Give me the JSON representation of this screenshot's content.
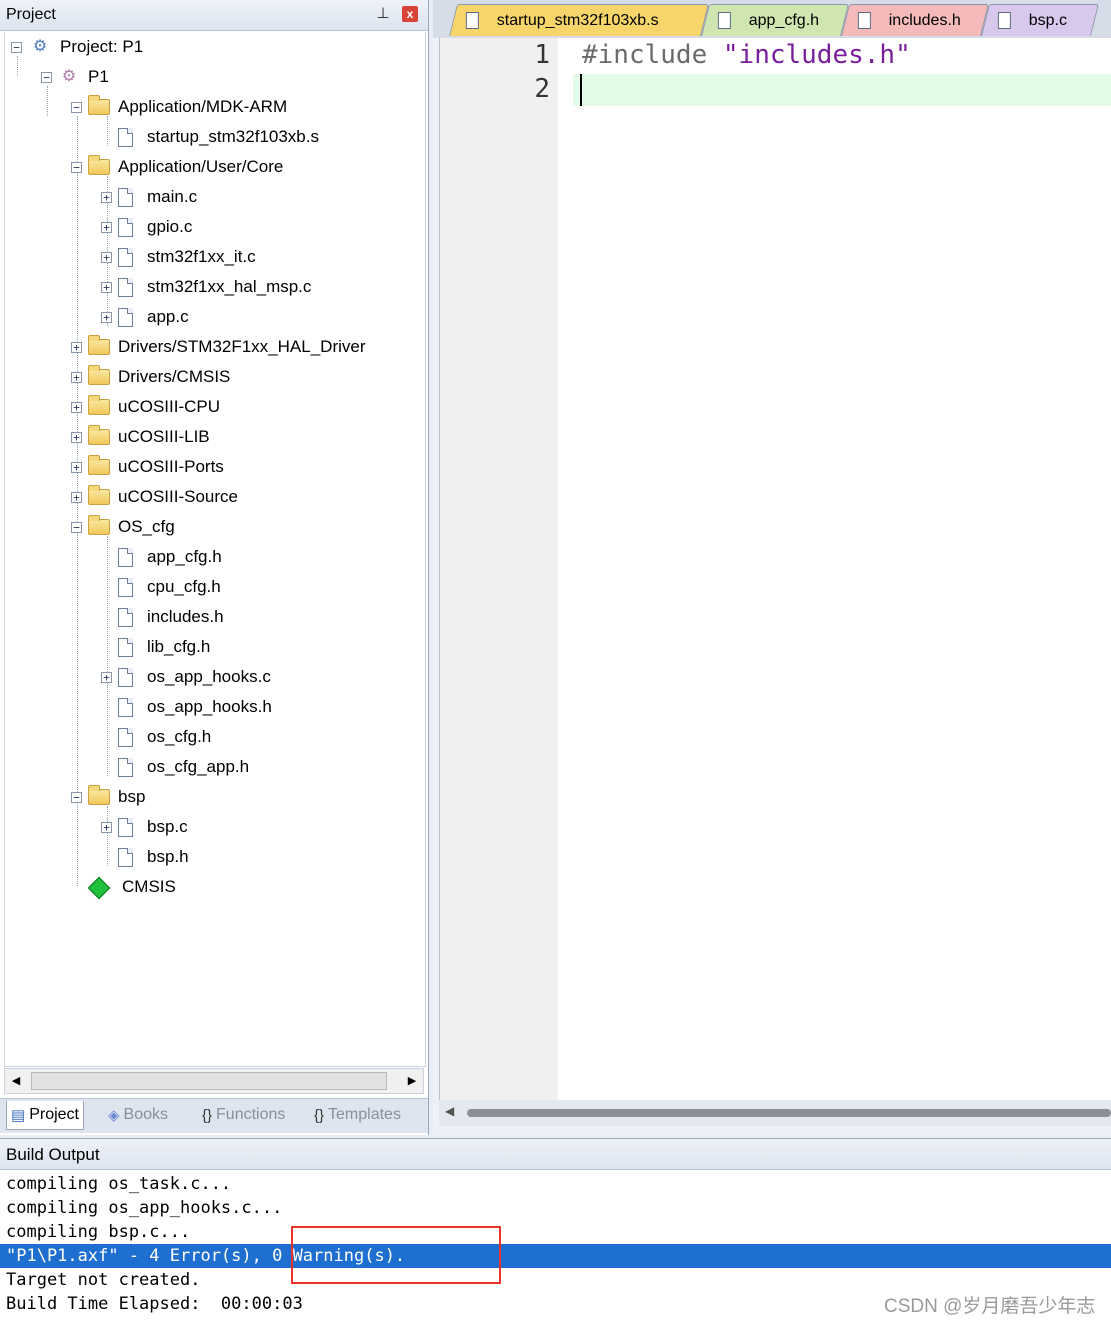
{
  "project_panel": {
    "title": "Project",
    "pin_glyph": "ᵖ",
    "close_glyph": "x",
    "tree": [
      {
        "label": "Project: P1",
        "kind": "project",
        "expander": "−"
      },
      {
        "label": "P1",
        "kind": "target",
        "expander": "−"
      },
      {
        "label": "Application/MDK-ARM",
        "kind": "folder-open",
        "expander": "−"
      },
      {
        "label": "startup_stm32f103xb.s",
        "kind": "file",
        "expander": ""
      },
      {
        "label": "Application/User/Core",
        "kind": "folder-open",
        "expander": "−"
      },
      {
        "label": "main.c",
        "kind": "file",
        "expander": "+"
      },
      {
        "label": "gpio.c",
        "kind": "file",
        "expander": "+"
      },
      {
        "label": "stm32f1xx_it.c",
        "kind": "file",
        "expander": "+"
      },
      {
        "label": "stm32f1xx_hal_msp.c",
        "kind": "file",
        "expander": "+"
      },
      {
        "label": "app.c",
        "kind": "file",
        "expander": "+"
      },
      {
        "label": "Drivers/STM32F1xx_HAL_Driver",
        "kind": "folder",
        "expander": "+"
      },
      {
        "label": "Drivers/CMSIS",
        "kind": "folder",
        "expander": "+"
      },
      {
        "label": "uCOSIII-CPU",
        "kind": "folder",
        "expander": "+"
      },
      {
        "label": "uCOSIII-LIB",
        "kind": "folder",
        "expander": "+"
      },
      {
        "label": "uCOSIII-Ports",
        "kind": "folder",
        "expander": "+"
      },
      {
        "label": "uCOSIII-Source",
        "kind": "folder",
        "expander": "+"
      },
      {
        "label": "OS_cfg",
        "kind": "folder-open",
        "expander": "−"
      },
      {
        "label": "app_cfg.h",
        "kind": "file",
        "expander": ""
      },
      {
        "label": "cpu_cfg.h",
        "kind": "file",
        "expander": ""
      },
      {
        "label": "includes.h",
        "kind": "file",
        "expander": ""
      },
      {
        "label": "lib_cfg.h",
        "kind": "file",
        "expander": ""
      },
      {
        "label": "os_app_hooks.c",
        "kind": "file",
        "expander": "+"
      },
      {
        "label": "os_app_hooks.h",
        "kind": "file",
        "expander": ""
      },
      {
        "label": "os_cfg.h",
        "kind": "file",
        "expander": ""
      },
      {
        "label": "os_cfg_app.h",
        "kind": "file",
        "expander": ""
      },
      {
        "label": "bsp",
        "kind": "folder-open",
        "expander": "−"
      },
      {
        "label": "bsp.c",
        "kind": "file",
        "expander": "+"
      },
      {
        "label": "bsp.h",
        "kind": "file",
        "expander": ""
      },
      {
        "label": "CMSIS",
        "kind": "cmsis",
        "expander": ""
      }
    ],
    "bottom_tabs": [
      {
        "label": "Project",
        "icon": "▤",
        "active": true
      },
      {
        "label": "Books",
        "icon": "◈",
        "active": false
      },
      {
        "label": "Functions",
        "icon": "{}",
        "active": false
      },
      {
        "label": "Templates",
        "icon": "{}",
        "active": false
      }
    ]
  },
  "editor": {
    "tabs": [
      {
        "label": "startup_stm32f103xb.s",
        "color": "#f7d56a"
      },
      {
        "label": "app_cfg.h",
        "color": "#cfe6b0"
      },
      {
        "label": "includes.h",
        "color": "#f4b9b9"
      },
      {
        "label": "bsp.c",
        "color": "#d8c8ec"
      }
    ],
    "lines": [
      {
        "number": "1",
        "include": "#include",
        "string": "\"includes.h\""
      },
      {
        "number": "2",
        "include": "",
        "string": ""
      }
    ]
  },
  "build_output": {
    "title": "Build Output",
    "lines": [
      {
        "text": "compiling os_task.c...",
        "selected": false
      },
      {
        "text": "compiling os_app_hooks.c...",
        "selected": false
      },
      {
        "text": "compiling bsp.c...",
        "selected": false
      },
      {
        "text": "\"P1\\P1.axf\" - 4 Error(s), 0 Warning(s).",
        "selected": true
      },
      {
        "text": "Target not created.",
        "selected": false
      },
      {
        "text": "Build Time Elapsed:  00:00:03",
        "selected": false
      }
    ]
  },
  "watermark": "CSDN @岁月磨吾少年志",
  "colors": {
    "selection": "#1e6fd0",
    "highlight_box": "#e8322c",
    "current_line": "#e4fbe8"
  }
}
